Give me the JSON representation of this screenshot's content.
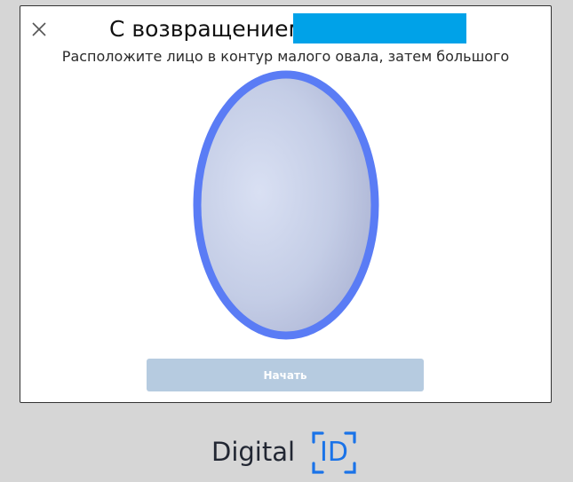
{
  "dialog": {
    "title": "С возвращением,",
    "subtitle": "Расположите лицо в контур малого овала, затем большого",
    "start_button_label": "Начать",
    "close_icon": "close-icon"
  },
  "brand": {
    "word": "Digital",
    "id_text": "ID"
  },
  "colors": {
    "oval_border": "#5a7cf5",
    "redaction": "#00a2e8",
    "button_disabled": "#b6cbe0",
    "brand_accent": "#1a73e8",
    "brand_text": "#222733"
  }
}
